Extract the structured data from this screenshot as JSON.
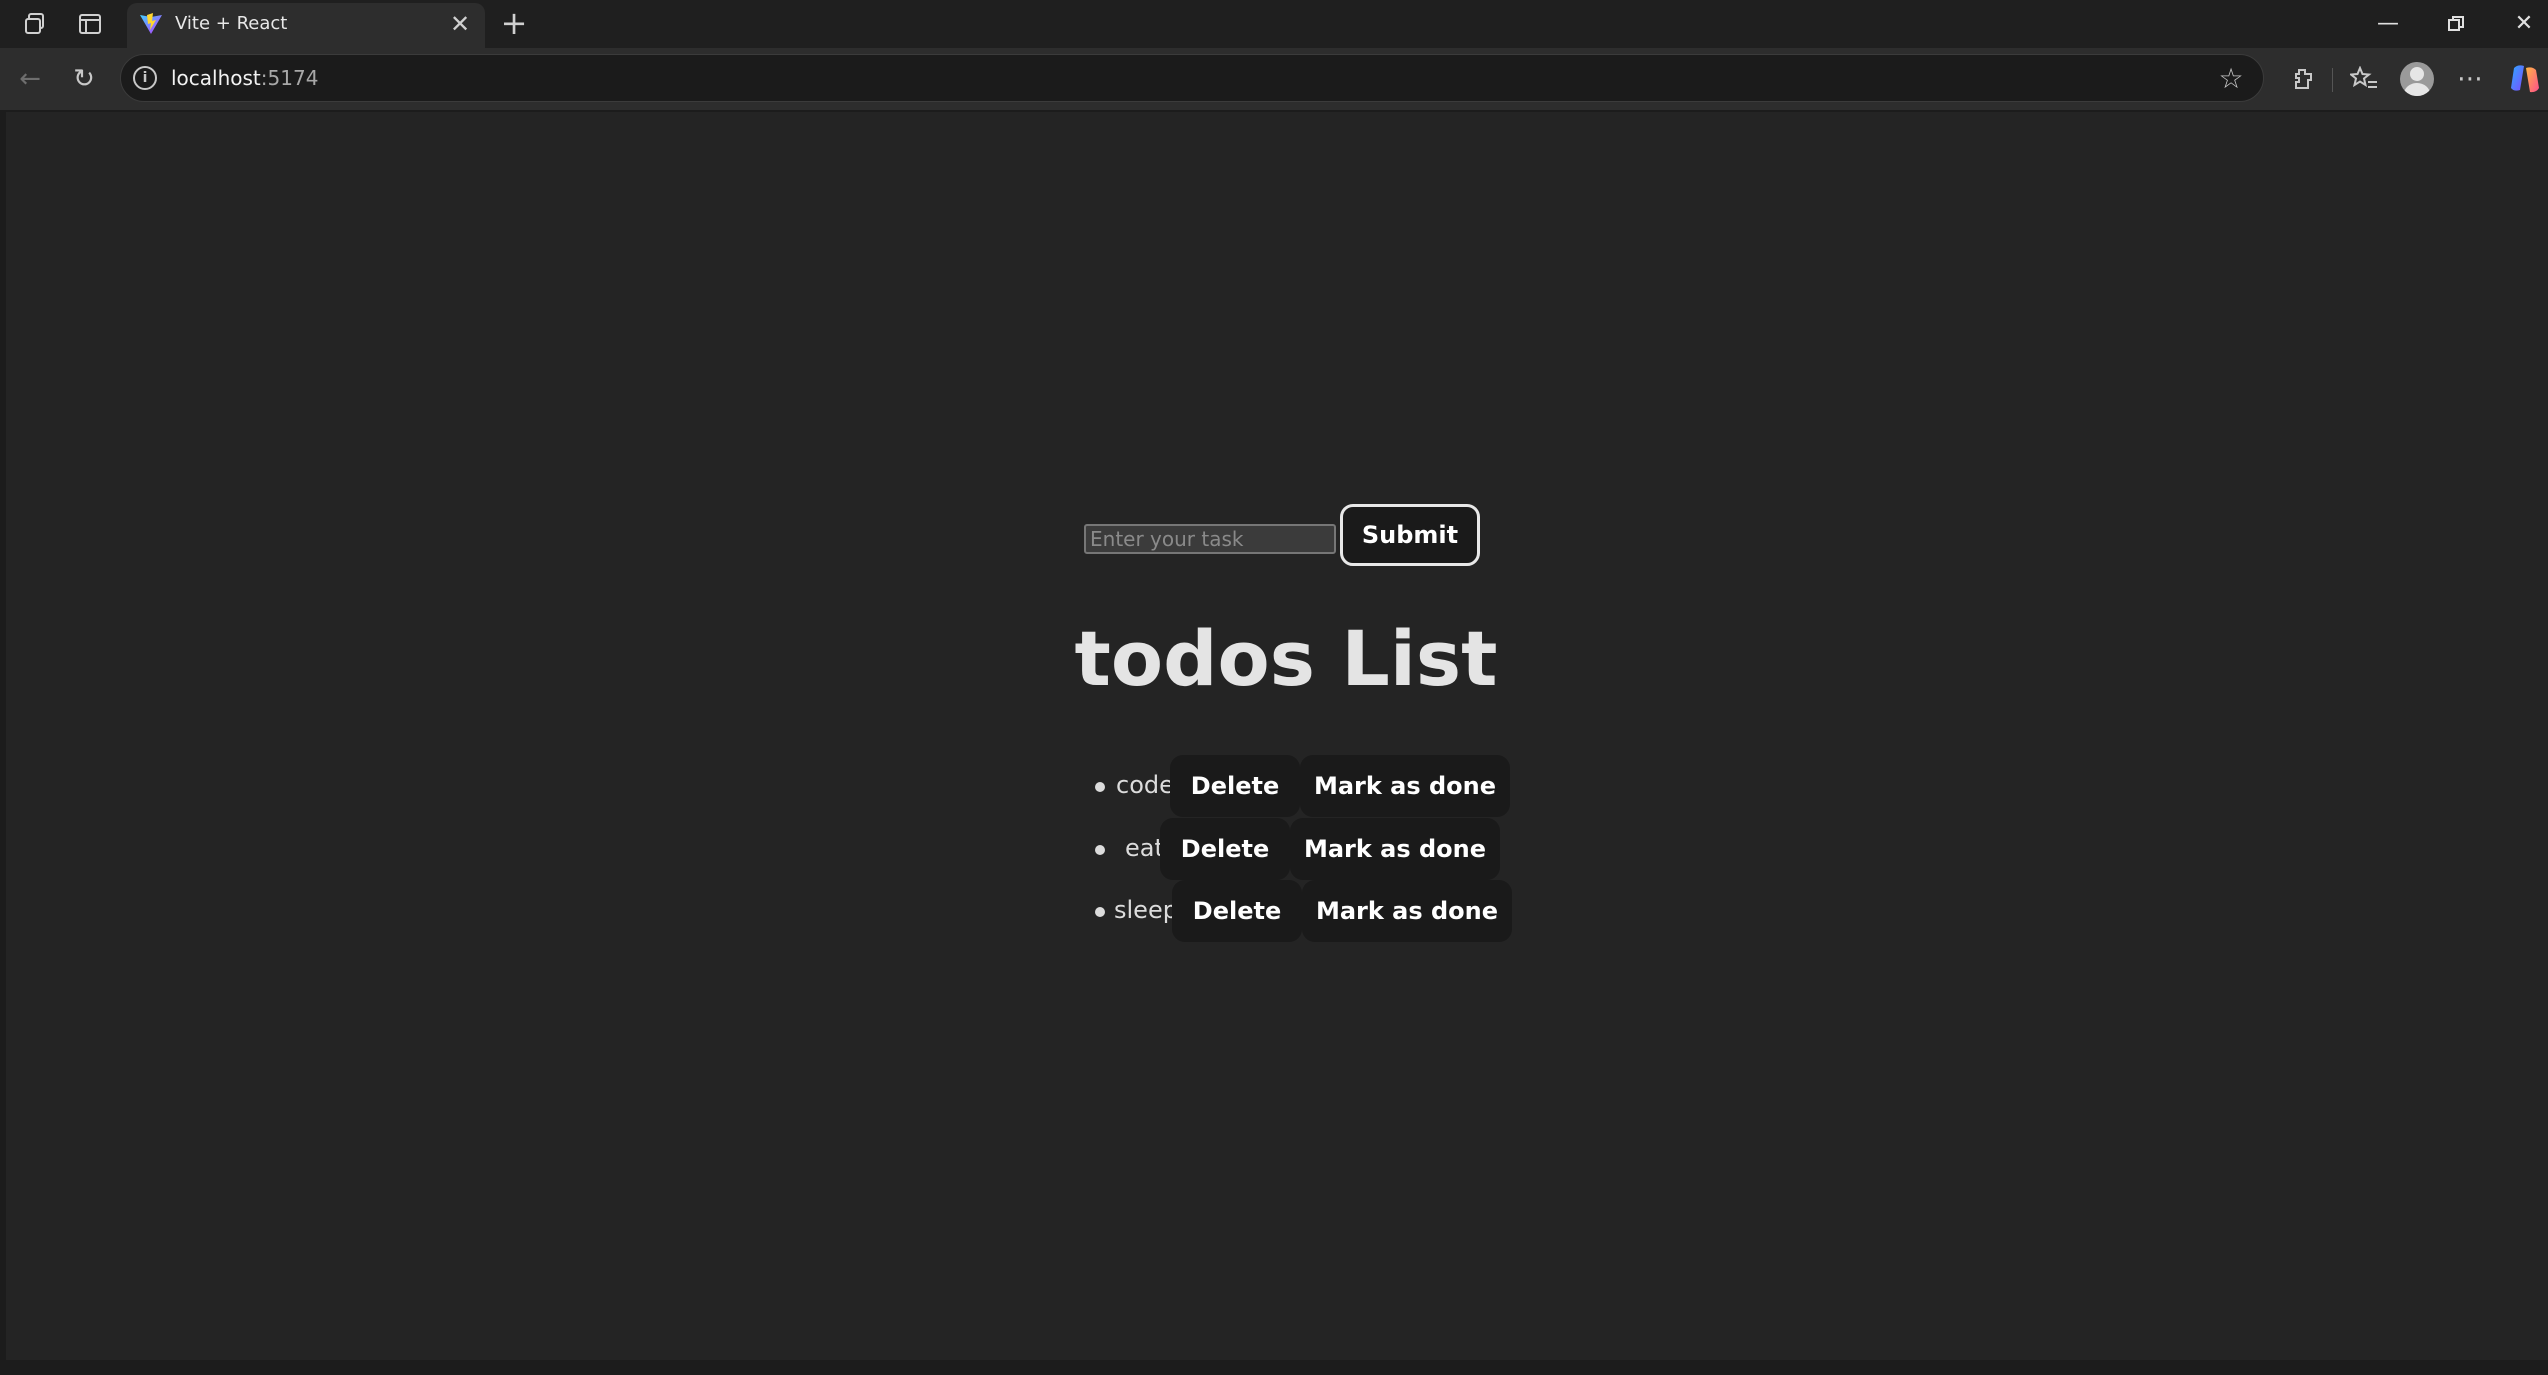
{
  "browser": {
    "tab_title": "Vite + React",
    "url_host": "localhost",
    "url_port": ":5174"
  },
  "app": {
    "input_placeholder": "Enter your task",
    "input_value": "",
    "submit_label": "Submit",
    "title": "todos List",
    "todos": [
      {
        "text": "code",
        "delete_label": "Delete",
        "done_label": "Mark as done"
      },
      {
        "text": "eat",
        "delete_label": "Delete",
        "done_label": "Mark as done"
      },
      {
        "text": "sleep",
        "delete_label": "Delete",
        "done_label": "Mark as done"
      }
    ]
  },
  "colors": {
    "page_background": "#242424",
    "button_background": "#1a1a1a",
    "text": "#dcdcdc"
  }
}
